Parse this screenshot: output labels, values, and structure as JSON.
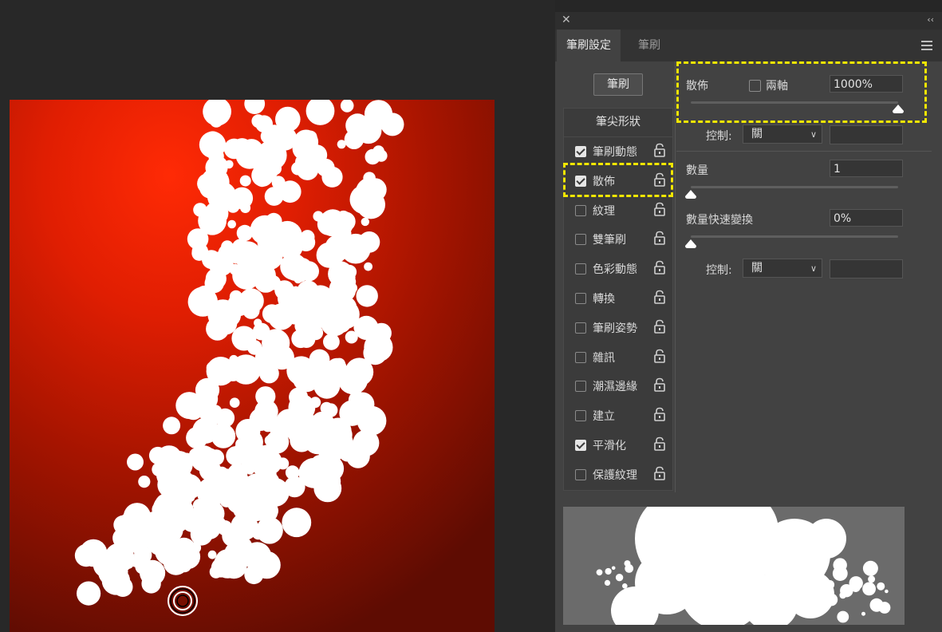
{
  "panel": {
    "tabs": [
      "筆刷設定",
      "筆刷"
    ],
    "brush_button": "筆刷",
    "tip_shape": "筆尖形狀",
    "options": [
      {
        "label": "筆刷動態",
        "checked": true
      },
      {
        "label": "散佈",
        "checked": true
      },
      {
        "label": "紋理",
        "checked": false
      },
      {
        "label": "雙筆刷",
        "checked": false
      },
      {
        "label": "色彩動態",
        "checked": false
      },
      {
        "label": "轉換",
        "checked": false
      },
      {
        "label": "筆刷姿勢",
        "checked": false
      },
      {
        "label": "雜訊",
        "checked": false
      },
      {
        "label": "潮濕邊緣",
        "checked": false
      },
      {
        "label": "建立",
        "checked": false
      },
      {
        "label": "平滑化",
        "checked": true
      },
      {
        "label": "保護紋理",
        "checked": false
      }
    ],
    "lock_icon": "lock-icon"
  },
  "scatter": {
    "label": "散佈",
    "both_axes_label": "兩軸",
    "both_axes_checked": false,
    "value": "1000%",
    "slider_fraction": 1.0,
    "control_label": "控制:",
    "control_value": "關"
  },
  "count": {
    "label": "數量",
    "value": "1",
    "slider_fraction": 0.0
  },
  "count_jitter": {
    "label": "數量快速變換",
    "value": "0%",
    "slider_fraction": 0.0,
    "control_label": "控制:",
    "control_value": "關"
  },
  "colors": {
    "highlight": "#f2e600",
    "panel_bg": "#424242",
    "canvas_red": "#e01e02"
  }
}
